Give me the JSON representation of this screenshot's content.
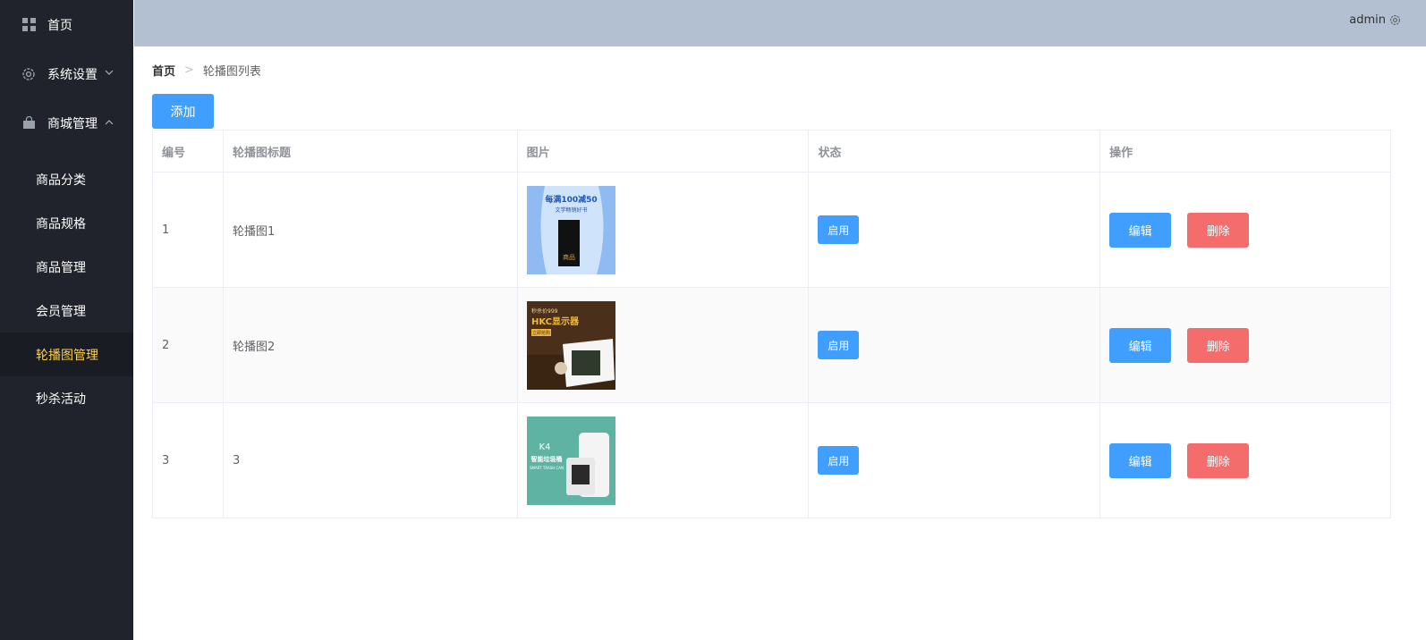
{
  "sidebar": {
    "home": "首页",
    "settings": "系统设置",
    "mall": "商城管理",
    "items": [
      {
        "label": "商品分类"
      },
      {
        "label": "商品规格"
      },
      {
        "label": "商品管理"
      },
      {
        "label": "会员管理"
      },
      {
        "label": "轮播图管理"
      },
      {
        "label": "秒杀活动"
      }
    ],
    "active_index": 4
  },
  "header": {
    "username": "admin"
  },
  "breadcrumb": {
    "home": "首页",
    "separator": ">",
    "current": "轮播图列表"
  },
  "toolbar": {
    "add_label": "添加"
  },
  "table": {
    "columns": [
      "编号",
      "轮播图标题",
      "图片",
      "状态",
      "操作"
    ],
    "rows": [
      {
        "id": "1",
        "title": "轮播图1",
        "status": "启用",
        "image_text": [
          "每满100减50",
          "文学畅销好书",
          "商品"
        ]
      },
      {
        "id": "2",
        "title": "轮播图2",
        "status": "启用",
        "image_text": [
          "秒杀价999",
          "HKC显示器",
          "立即抢购"
        ]
      },
      {
        "id": "3",
        "title": "3",
        "status": "启用",
        "image_text": [
          "K4",
          "智能垃圾桶",
          "SMART TRASH CAN"
        ]
      }
    ],
    "edit_label": "编辑",
    "delete_label": "删除"
  },
  "colors": {
    "sidebar_bg": "#20232c",
    "active_text": "#ffd04b",
    "header_bg": "#b3c0d1",
    "primary": "#409eff",
    "danger": "#f56c6c"
  }
}
